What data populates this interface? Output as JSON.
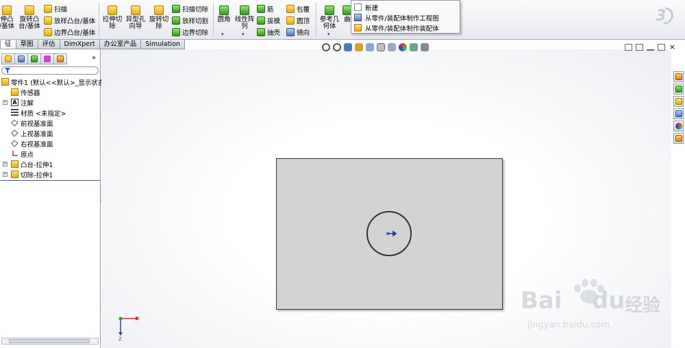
{
  "ribbon": {
    "big_buttons": [
      {
        "name": "extruded-boss-button",
        "label": "伸凸\n/基体"
      },
      {
        "name": "revolved-boss-button",
        "label": "旋转凸\n台/基体"
      },
      {
        "name": "extruded-cut-button",
        "label": "拉伸切\n除"
      },
      {
        "name": "hole-wizard-button",
        "label": "异型孔\n向导"
      },
      {
        "name": "revolved-cut-button",
        "label": "旋转切\n除"
      },
      {
        "name": "fillet-button",
        "label": "圆角"
      },
      {
        "name": "linear-pattern-button",
        "label": "线性阵\n列"
      },
      {
        "name": "reference-geometry-button",
        "label": "参考几\n何体"
      },
      {
        "name": "curves-button",
        "label": "曲"
      }
    ],
    "small_buttons": {
      "swept_boss": "扫描",
      "lofted_boss": "放样凸台/基体",
      "boundary_boss": "边界凸台/基体",
      "swept_cut": "扫描切除",
      "lofted_cut": "放样切割",
      "boundary_cut": "边界切除",
      "rib": "筋",
      "draft": "拔模",
      "shell": "抽壳",
      "wrap": "包覆",
      "dome": "圆顶",
      "mirror": "镜向"
    }
  },
  "new_menu": {
    "items": [
      "新建",
      "从零件/装配体制作工程图",
      "从零件/装配体制作装配体"
    ]
  },
  "tabs": [
    "征",
    "草图",
    "评估",
    "DimXpert",
    "办公室产品",
    "Simulation"
  ],
  "tree": {
    "root": "零件1 (默认<<默认>_显示状态",
    "items": [
      {
        "label": "传感器",
        "expandable": false,
        "icon": "sensor-icon"
      },
      {
        "label": "注解",
        "expandable": true,
        "icon": "annotation-icon"
      },
      {
        "label": "材质 <未指定>",
        "expandable": false,
        "icon": "material-icon"
      },
      {
        "label": "前视基准面",
        "expandable": false,
        "icon": "plane-icon"
      },
      {
        "label": "上视基准面",
        "expandable": false,
        "icon": "plane-icon"
      },
      {
        "label": "右视基准面",
        "expandable": false,
        "icon": "plane-icon"
      },
      {
        "label": "原点",
        "expandable": false,
        "icon": "origin-icon"
      },
      {
        "label": "凸台-拉伸1",
        "expandable": true,
        "icon": "boss-extrude-icon"
      },
      {
        "label": "切除-拉伸1",
        "expandable": true,
        "icon": "cut-extrude-icon"
      }
    ]
  },
  "triad": {
    "x": "X",
    "z": "Z"
  },
  "watermark": {
    "brand": "Bai",
    "brand2": "du",
    "cn": "经验",
    "url": "jingyan.baidu.com"
  }
}
